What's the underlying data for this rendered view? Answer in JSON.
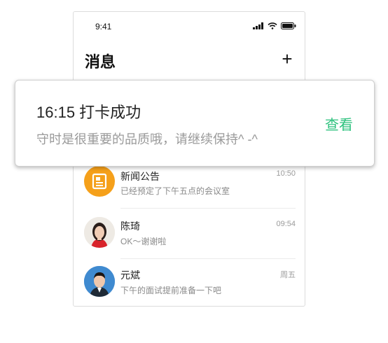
{
  "status": {
    "time": "9:41"
  },
  "header": {
    "title": "消息",
    "add_label": "+"
  },
  "notification": {
    "title": "16:15 打卡成功",
    "body": "守时是很重要的品质哦，请继续保持^ -^",
    "action_label": "查看"
  },
  "messages": [
    {
      "name": "新闻公告",
      "preview": "已经预定了下午五点的会议室",
      "time": "10:50",
      "avatar": "announcement-icon"
    },
    {
      "name": "陈琦",
      "preview": "OK～谢谢啦",
      "time": "09:54",
      "avatar": "female-avatar"
    },
    {
      "name": "元斌",
      "preview": "下午的面试提前准备一下吧",
      "time": "周五",
      "avatar": "male-avatar"
    }
  ],
  "colors": {
    "accent": "#2ec27e",
    "announcement": "#f5a01a"
  }
}
